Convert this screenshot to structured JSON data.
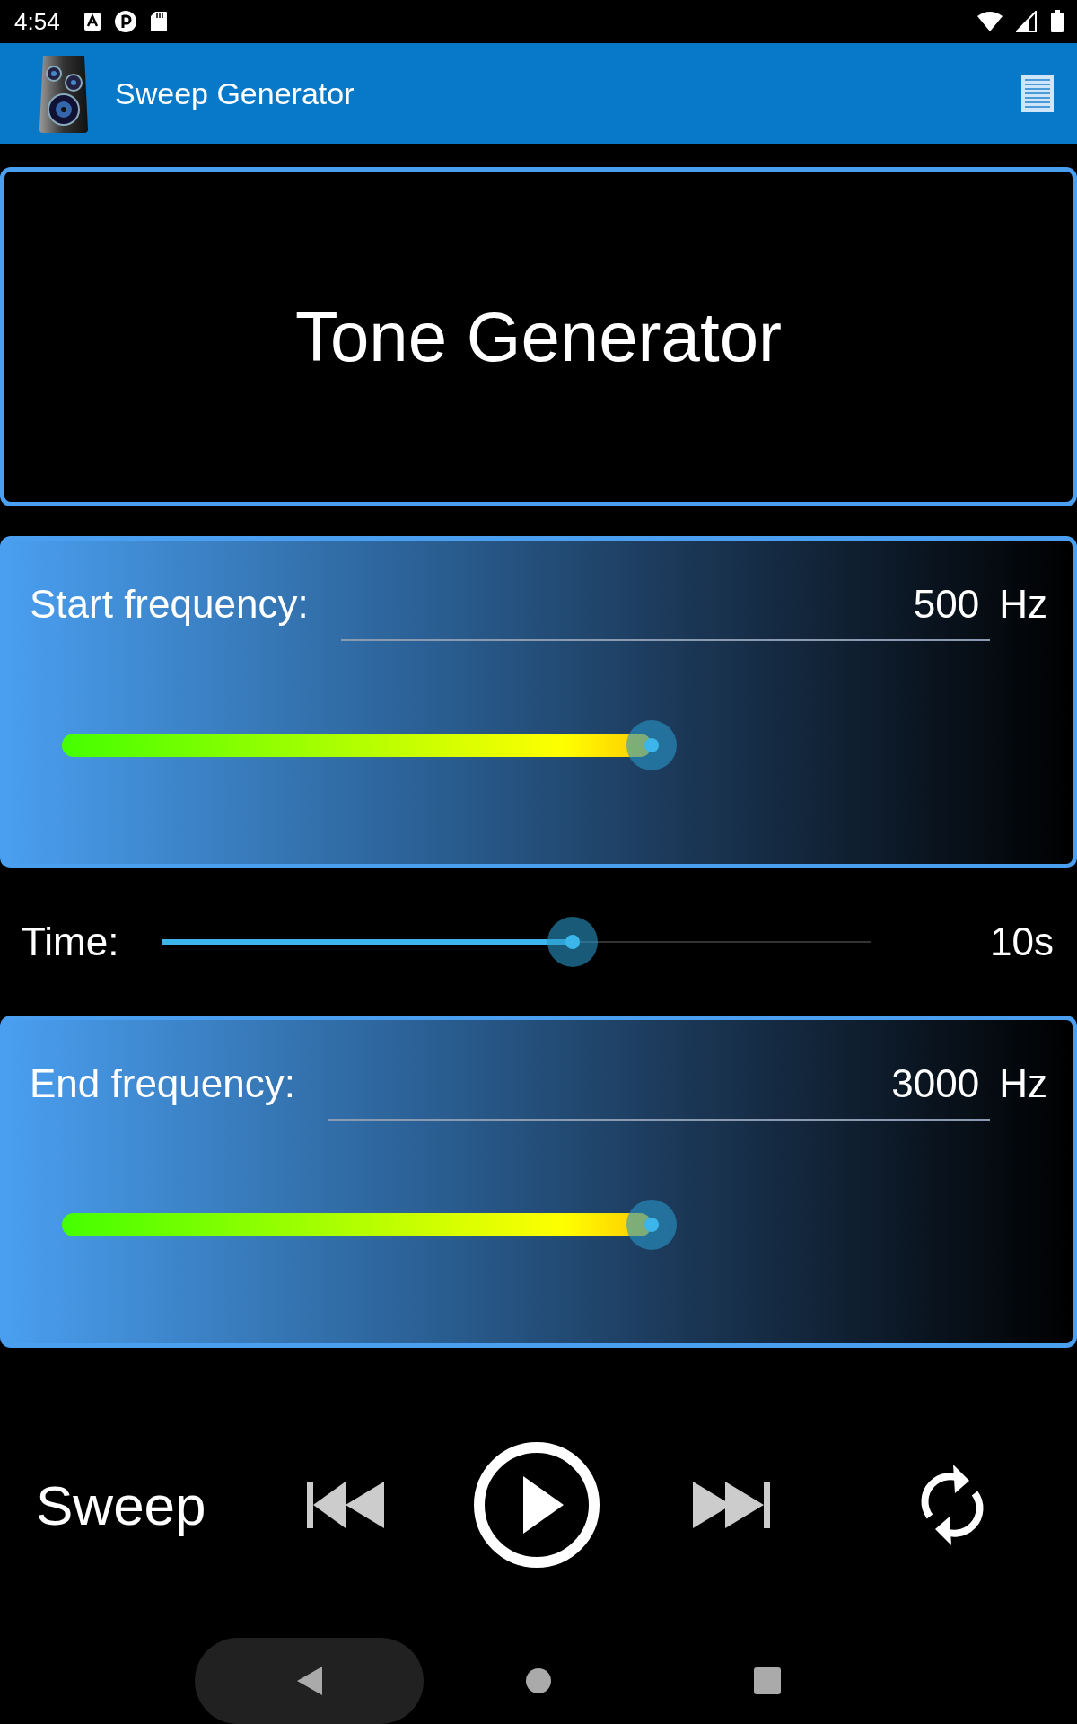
{
  "status_bar": {
    "time": "4:54"
  },
  "app_bar": {
    "title": "Sweep Generator"
  },
  "display": {
    "text": "Tone Generator"
  },
  "frequencies": [
    {
      "label": "Start frequency:",
      "value": "500",
      "unit": "Hz",
      "level": 0.62
    },
    {
      "label": "End frequency:",
      "value": "3000",
      "unit": "Hz",
      "level": 0.62
    }
  ],
  "time": {
    "label": "Time:",
    "level": 0.58,
    "reading": "10s"
  },
  "controls": {
    "mode": "Sweep"
  }
}
